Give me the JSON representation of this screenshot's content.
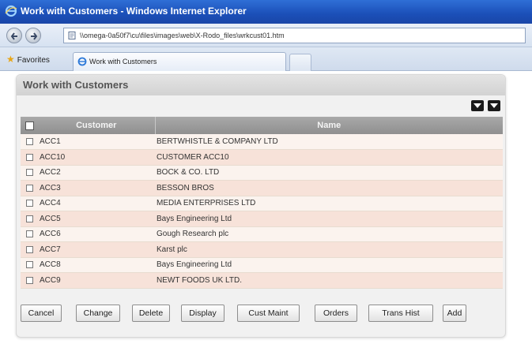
{
  "window": {
    "title": "Work with Customers - Windows Internet Explorer"
  },
  "browser": {
    "address": "\\\\omega-0a50f7\\cu\\files\\images\\web\\X-Rodo_files\\wrkcust01.htm",
    "favorites_label": "Favorites",
    "tab_label": "Work with Customers"
  },
  "panel": {
    "title": "Work with Customers"
  },
  "table": {
    "columns": [
      "Customer",
      "Name"
    ],
    "rows": [
      {
        "code": "ACC1",
        "name": "BERTWHISTLE & COMPANY LTD"
      },
      {
        "code": "ACC10",
        "name": "CUSTOMER ACC10"
      },
      {
        "code": "ACC2",
        "name": "BOCK & CO. LTD"
      },
      {
        "code": "ACC3",
        "name": "BESSON BROS"
      },
      {
        "code": "ACC4",
        "name": "MEDIA ENTERPRISES LTD"
      },
      {
        "code": "ACC5",
        "name": "Bays Engineering Ltd"
      },
      {
        "code": "ACC6",
        "name": "Gough Research plc"
      },
      {
        "code": "ACC7",
        "name": "Karst plc"
      },
      {
        "code": "ACC8",
        "name": "Bays Engineering Ltd"
      },
      {
        "code": "ACC9",
        "name": "NEWT FOODS UK LTD."
      }
    ]
  },
  "buttons": {
    "cancel": "Cancel",
    "change": "Change",
    "delete": "Delete",
    "display": "Display",
    "cust_maint": "Cust Maint",
    "orders": "Orders",
    "trans_hist": "Trans Hist",
    "add": "Add"
  },
  "icons": {
    "browser": "ie-icon",
    "back": "back-arrow-icon",
    "forward": "forward-arrow-icon",
    "page": "page-icon",
    "favorites": "star-icon",
    "download_1": "download-icon",
    "download_2": "download-icon"
  },
  "colors": {
    "title_bar": "#1b4fb8",
    "row_odd": "#fbf3ee",
    "row_even": "#f7e2d9",
    "header": "#999999"
  }
}
